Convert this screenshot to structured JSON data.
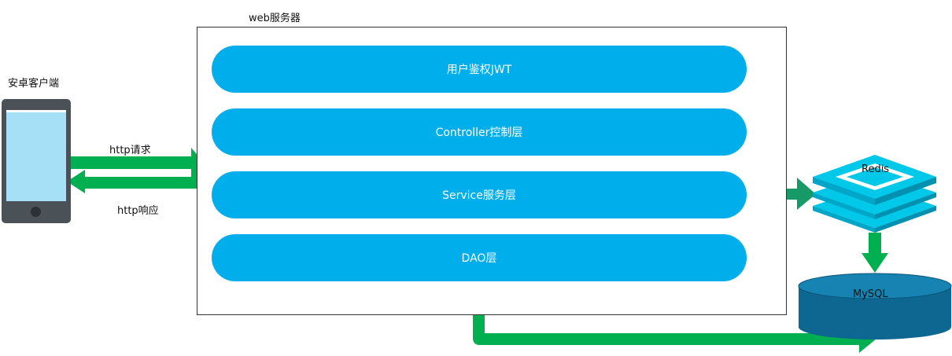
{
  "client": {
    "label": "安卓客户端"
  },
  "server": {
    "label": "web服务器",
    "layers": [
      "用户鉴权JWT",
      "Controller控制层",
      "Service服务层",
      "DAO层"
    ]
  },
  "connections": {
    "request_label": "http请求",
    "response_label": "http响应"
  },
  "storage": {
    "cache_label": "Redis",
    "database_label": "MySQL"
  },
  "colors": {
    "layer_fill": "#00AEEB",
    "arrow_green": "#00B050",
    "arrow_dark_green": "#189968",
    "redis_cyan": "#00C8E8",
    "mysql_blue": "#0E6791"
  }
}
